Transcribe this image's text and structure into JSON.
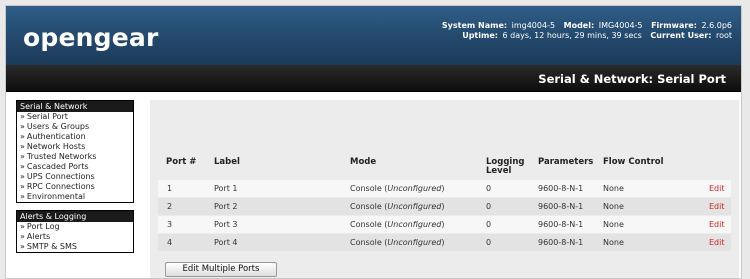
{
  "header": {
    "logo": "opengear",
    "system_name_label": "System Name:",
    "system_name": "img4004-5",
    "model_label": "Model:",
    "model": "IMG4004-5",
    "firmware_label": "Firmware:",
    "firmware": "2.6.0p6",
    "uptime_label": "Uptime:",
    "uptime": "6 days, 12 hours, 29 mins, 39 secs",
    "user_label": "Current User:",
    "user": "root"
  },
  "page_title": "Serial & Network: Serial Port",
  "sidebar": {
    "sections": [
      {
        "title": "Serial & Network",
        "items": [
          "Serial Port",
          "Users & Groups",
          "Authentication",
          "Network Hosts",
          "Trusted Networks",
          "Cascaded Ports",
          "UPS Connections",
          "RPC Connections",
          "Environmental"
        ]
      },
      {
        "title": "Alerts & Logging",
        "items": [
          "Port Log",
          "Alerts",
          "SMTP & SMS"
        ]
      }
    ],
    "arrow": "»"
  },
  "table": {
    "headers": {
      "port": "Port #",
      "label": "Label",
      "mode": "Mode",
      "logging_line1": "Logging",
      "logging_line2": "Level",
      "parameters": "Parameters",
      "flow": "Flow Control"
    },
    "rows": [
      {
        "port": "1",
        "label": "Port 1",
        "mode": "Console (",
        "mode_em": "Unconfigured",
        "mode_end": ")",
        "logging": "0",
        "parameters": "9600-8-N-1",
        "flow": "None",
        "edit": "Edit"
      },
      {
        "port": "2",
        "label": "Port 2",
        "mode": "Console (",
        "mode_em": "Unconfigured",
        "mode_end": ")",
        "logging": "0",
        "parameters": "9600-8-N-1",
        "flow": "None",
        "edit": "Edit"
      },
      {
        "port": "3",
        "label": "Port 3",
        "mode": "Console (",
        "mode_em": "Unconfigured",
        "mode_end": ")",
        "logging": "0",
        "parameters": "9600-8-N-1",
        "flow": "None",
        "edit": "Edit"
      },
      {
        "port": "4",
        "label": "Port 4",
        "mode": "Console (",
        "mode_em": "Unconfigured",
        "mode_end": ")",
        "logging": "0",
        "parameters": "9600-8-N-1",
        "flow": "None",
        "edit": "Edit"
      }
    ]
  },
  "edit_multiple_label": "Edit Multiple Ports",
  "colors": {
    "header_blue": "#23486c",
    "edit_red": "#d32222"
  }
}
